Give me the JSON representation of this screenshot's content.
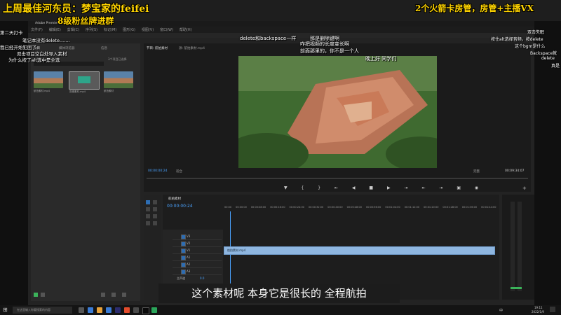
{
  "overlay": {
    "top_left_title": "上周最佳河东员：梦宝家的feifei",
    "top_left_subtitle": "8级粉丝牌进群",
    "top_right": "2个火箭卡房管，房管+主播VX",
    "danmaku_1": "delete和backspace一样",
    "danmaku_2": "那是删除键啊",
    "danmaku_3": "咋把视频的长度变长啊",
    "danmaku_4": "前面那里的，你不是一个人",
    "danmaku_5": "晚上好 同学们",
    "subtitle": "这个素材呢 本身它是很长的 全程航拍"
  },
  "left_chat": [
    "第二天打卡",
    "笔记本没有delete.......",
    "我已经开始犯困了",
    "双击项目空白处导入素材",
    "为什么按了alt选中是全选"
  ],
  "right_chat": [
    "双击失眠",
    "按住alt选择音频，按delete",
    "这个bgm是什么",
    "Backspace就",
    "delete",
    "真是"
  ],
  "premiere": {
    "title_left": "Adobe Premiere",
    "menu": [
      "文件(F)",
      "编辑(E)",
      "剪辑(C)",
      "序列(S)",
      "标记(M)",
      "图形(G)",
      "视图(V)",
      "窗口(W)",
      "帮助(H)"
    ],
    "project_tabs": [
      "项目",
      "媒体浏览器",
      "信息"
    ],
    "project_info": "3个项目已选择",
    "clips": [
      {
        "name": "航拍素材.mp4",
        "duration": "9:04:04"
      },
      {
        "name": "剪辑素材.mp4",
        "duration": "0:22"
      },
      {
        "name": "航拍素材",
        "duration": "9:04"
      }
    ],
    "monitor_tabs": [
      "节目: 航拍素材",
      "源: 航拍素材.mp4"
    ],
    "monitor_timecode": "00:00:00:24",
    "monitor_fit": "适合",
    "monitor_full": "完整",
    "monitor_duration": "00:09:34:07",
    "timeline_tab": "航拍素材",
    "timeline_timecode": "00:00:00:24",
    "ruler": [
      "00:00",
      "00:00:00",
      "00:00:08:00",
      "00:00:16:00",
      "00:00:24:00",
      "00:00:32:00",
      "00:00:40:00",
      "00:00:48:00",
      "00:00:56:00",
      "00:01:04:00",
      "00:01:12:00",
      "00:01:20:00",
      "00:01:28:00",
      "00:01:36:00",
      "00:01:44:00"
    ],
    "tracks": [
      "V3",
      "V2",
      "V1",
      "A1",
      "A2",
      "A3"
    ],
    "clip_label": "航拍素材.mp4",
    "master": "主声道",
    "master_val": "0.0"
  },
  "taskbar": {
    "search_placeholder": "在这里输入你要搜索的内容",
    "clock_time": "19:11",
    "clock_date": "2022/1/9",
    "ime": "中"
  },
  "colors": {
    "accent": "#2d6db3",
    "timecode": "#4aa3ff",
    "clip": "#8eb6e0",
    "overlay_yellow": "#ffd400"
  }
}
